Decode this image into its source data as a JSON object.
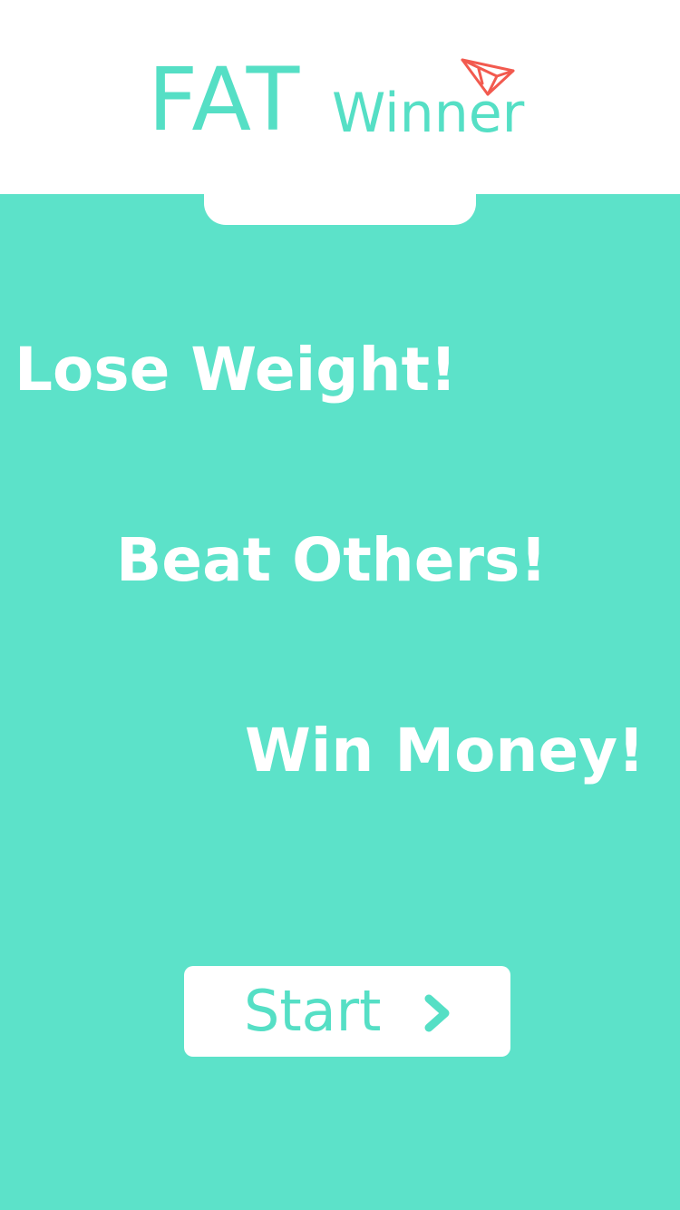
{
  "logo": {
    "word1": "FAT",
    "word2": "Winner",
    "icon": "paper-plane-icon"
  },
  "slogans": [
    "Lose Weight!",
    "Beat Others!",
    "Win Money!"
  ],
  "start_button": {
    "label": "Start",
    "icon": "chevron-right-icon"
  },
  "colors": {
    "background": "#5ce2c9",
    "accent": "#55dfc5",
    "plane": "#f25a4f",
    "white": "#ffffff"
  }
}
